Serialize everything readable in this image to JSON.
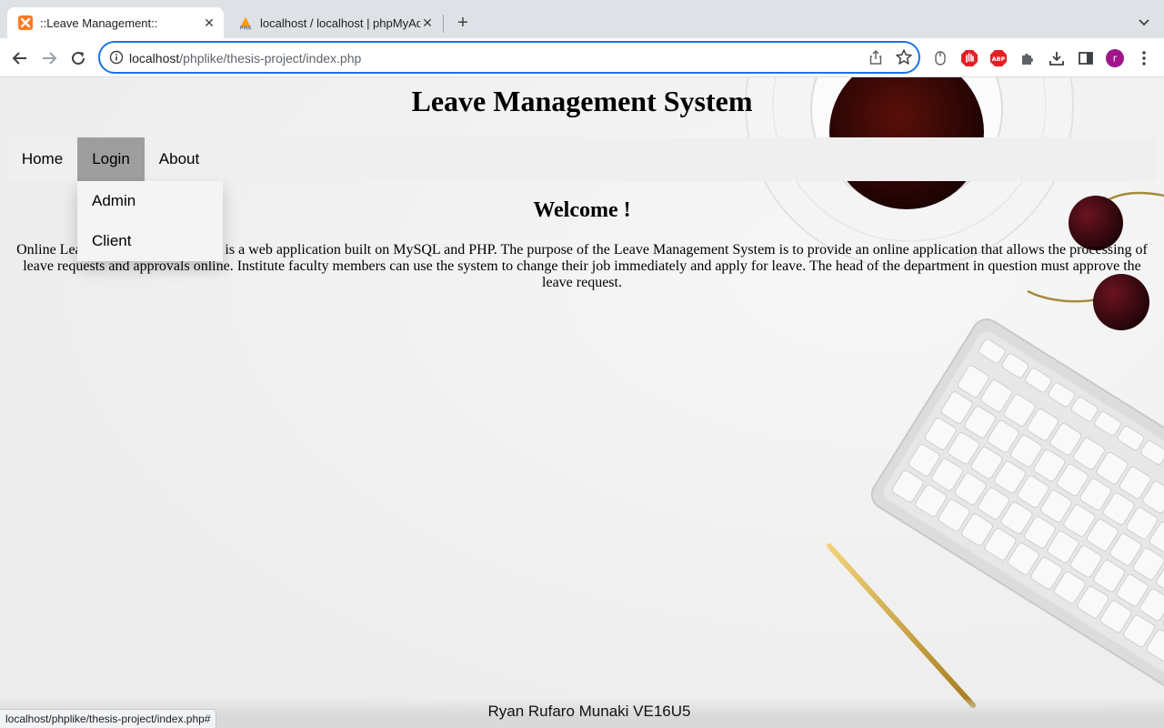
{
  "browser": {
    "tabs": [
      {
        "title": "::Leave Management::",
        "active": true
      },
      {
        "title": "localhost / localhost | phpMyAdmin",
        "active": false
      }
    ],
    "url": {
      "host": "localhost",
      "path": "/phplike/thesis-project/index.php"
    },
    "profile_initial": "r",
    "status_url": "localhost/phplike/thesis-project/index.php#",
    "colors": {
      "accent": "#1a73e8",
      "profile": "#a0168a",
      "abp": "#e41e26"
    }
  },
  "page": {
    "title": "Leave Management System",
    "nav": {
      "home": "Home",
      "login": "Login",
      "about": "About"
    },
    "dropdown": {
      "admin": "Admin",
      "client": "Client"
    },
    "welcome": "Welcome !",
    "intro": "Online Leave Management System is a web application built on MySQL and PHP. The purpose of the Leave Management System is to provide an online application that allows the processing of leave requests and approvals online. Institute faculty members can use the system to change their job immediately and apply for leave. The head of the department in question must approve the leave request.",
    "footer": "Ryan Rufaro Munaki VE16U5"
  }
}
